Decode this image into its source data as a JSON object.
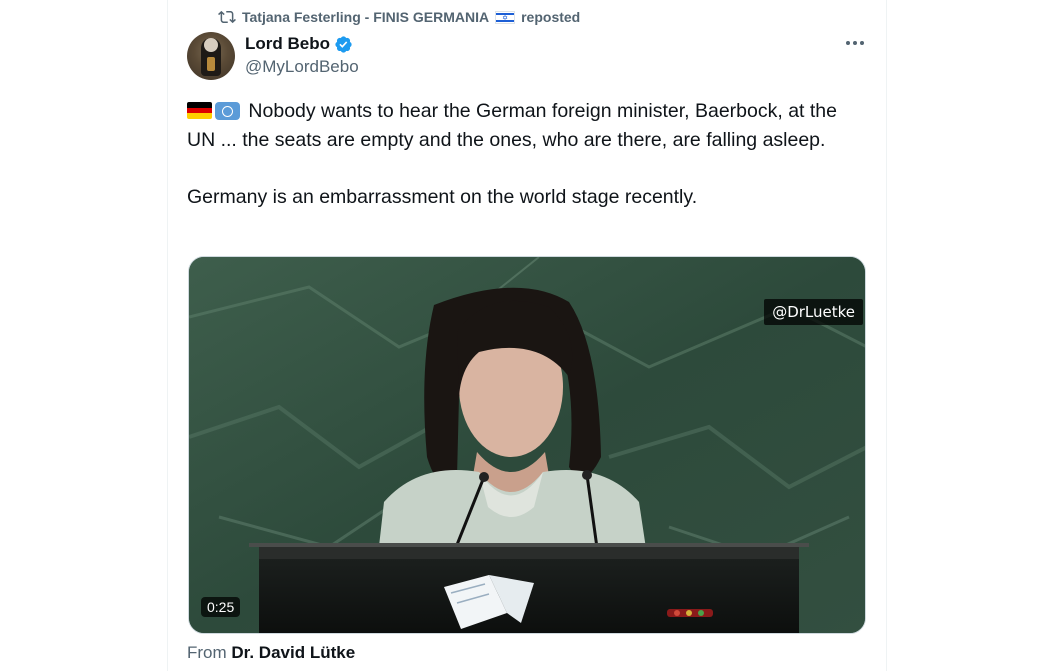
{
  "repost": {
    "icon": "repost-icon",
    "reposter": "Tatjana Festerling - FINIS GERMANIA",
    "flag": "israel-flag-emoji",
    "suffix": "reposted"
  },
  "author": {
    "name": "Lord Bebo",
    "verified": true,
    "handle": "@MyLordBebo",
    "verified_color": "#1d9bf0"
  },
  "tweet": {
    "emojis": [
      "germany-flag-emoji",
      "united-nations-emoji"
    ],
    "paragraph1": "Nobody wants to hear the German foreign minister, Baerbock, at the UN ... the seats are empty and the ones, who are there, are falling asleep.",
    "paragraph2": "Germany is an embarrassment on the world stage recently."
  },
  "media": {
    "watermark": "@DrLuetke",
    "duration": "0:25"
  },
  "from": {
    "prefix": "From",
    "source": "Dr. David Lütke"
  },
  "colors": {
    "text": "#0f1419",
    "secondary": "#536471",
    "accent": "#1d9bf0"
  }
}
